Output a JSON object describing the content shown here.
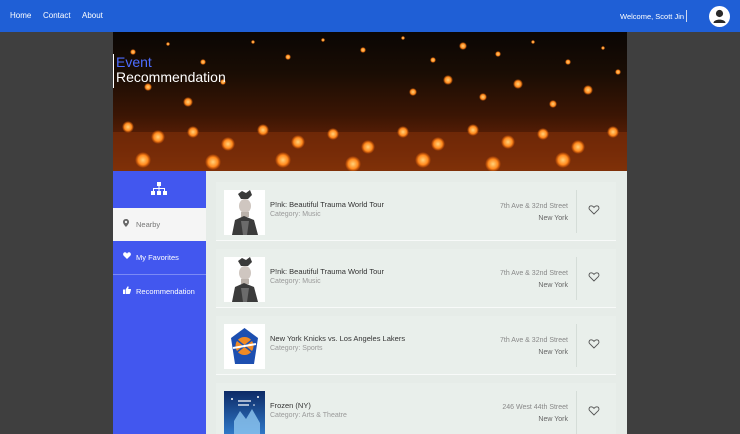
{
  "nav": {
    "home": "Home",
    "contact": "Contact",
    "about": "About"
  },
  "user": {
    "welcome": "Welcome, Scott Jin"
  },
  "hero": {
    "title_line1": "Event",
    "title_line2": "Recommendation"
  },
  "sidebar": {
    "items": [
      {
        "label": "Nearby",
        "icon": "map-marker-icon"
      },
      {
        "label": "My Favorites",
        "icon": "heart-icon"
      },
      {
        "label": "Recommendation",
        "icon": "thumbs-up-icon"
      }
    ]
  },
  "events": [
    {
      "name": "P!nk: Beautiful Trauma World Tour",
      "category": "Category: Music",
      "street": "7th Ave & 32nd Street",
      "city": "New York"
    },
    {
      "name": "P!nk: Beautiful Trauma World Tour",
      "category": "Category: Music",
      "street": "7th Ave & 32nd Street",
      "city": "New York"
    },
    {
      "name": "New York Knicks vs. Los Angeles Lakers",
      "category": "Category: Sports",
      "street": "7th Ave & 32nd Street",
      "city": "New York"
    },
    {
      "name": "Frozen (NY)",
      "category": "Category: Arts & Theatre",
      "street": "246 West 44th Street",
      "city": "New York"
    }
  ],
  "colors": {
    "topbar": "#1f5fd6",
    "sidebar": "#4257ef",
    "title_accent": "#4d6cff"
  }
}
